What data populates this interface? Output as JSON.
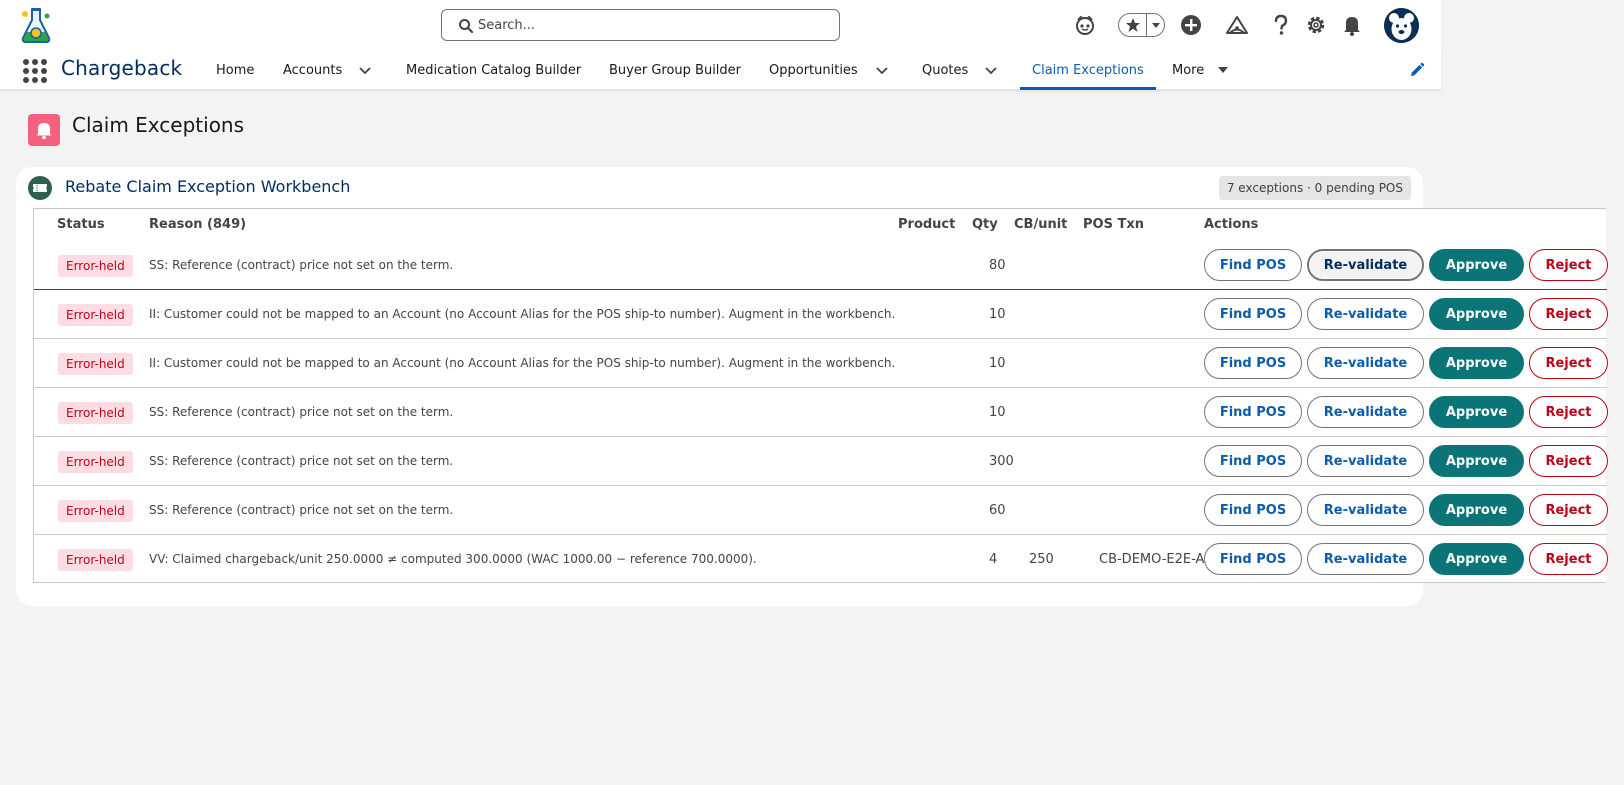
{
  "header": {
    "search_placeholder": "Search...",
    "icons": [
      "app-logo",
      "search-icon",
      "assistant-icon",
      "favorites-star-icon",
      "favorites-caret-icon",
      "global-actions-plus-icon",
      "trailhead-icon",
      "help-icon",
      "setup-gear-icon",
      "notifications-bell-icon",
      "avatar"
    ]
  },
  "nav": {
    "app_name": "Chargeback",
    "items": [
      {
        "label": "Home"
      },
      {
        "label": "Accounts"
      },
      {
        "label": "Medication Catalog Builder"
      },
      {
        "label": "Buyer Group Builder"
      },
      {
        "label": "Opportunities"
      },
      {
        "label": "Quotes"
      },
      {
        "label": "Claim Exceptions"
      },
      {
        "label": "More"
      }
    ],
    "active": "Claim Exceptions"
  },
  "page": {
    "title": "Claim Exceptions",
    "icon": "bell-icon",
    "accent_color": "#f4617f"
  },
  "card": {
    "title": "Rebate Claim Exception Workbench",
    "badge": "7 exceptions · 0 pending POS"
  },
  "table": {
    "headers": {
      "status": "Status",
      "reason": "Reason (849)",
      "product": "Product",
      "qty": "Qty",
      "cb_unit": "CB/unit",
      "pos_txn": "POS Txn",
      "actions": "Actions"
    },
    "buttons": {
      "find_pos": "Find POS",
      "revalidate": "Re-validate",
      "approve": "Approve",
      "reject": "Reject"
    },
    "rows": [
      {
        "status": "Error-held",
        "reason": "SS: Reference (contract) price not set on the term.",
        "product": "",
        "qty": "80",
        "cb_unit": "",
        "pos_txn": ""
      },
      {
        "status": "Error-held",
        "reason": "II: Customer could not be mapped to an Account (no Account Alias for the POS ship-to number). Augment in the workbench.",
        "product": "",
        "qty": "10",
        "cb_unit": "",
        "pos_txn": ""
      },
      {
        "status": "Error-held",
        "reason": "II: Customer could not be mapped to an Account (no Account Alias for the POS ship-to number). Augment in the workbench.",
        "product": "",
        "qty": "10",
        "cb_unit": "",
        "pos_txn": ""
      },
      {
        "status": "Error-held",
        "reason": "SS: Reference (contract) price not set on the term.",
        "product": "",
        "qty": "10",
        "cb_unit": "",
        "pos_txn": ""
      },
      {
        "status": "Error-held",
        "reason": "SS: Reference (contract) price not set on the term.",
        "product": "",
        "qty": "300",
        "cb_unit": "",
        "pos_txn": ""
      },
      {
        "status": "Error-held",
        "reason": "SS: Reference (contract) price not set on the term.",
        "product": "",
        "qty": "60",
        "cb_unit": "",
        "pos_txn": ""
      },
      {
        "status": "Error-held",
        "reason": "VV: Claimed chargeback/unit 250.0000 ≠ computed 300.0000 (WAC 1000.00 − reference 700.0000).",
        "product": "",
        "qty": "4",
        "cb_unit": "250",
        "pos_txn": "CB-DEMO-E2E-A"
      }
    ]
  }
}
